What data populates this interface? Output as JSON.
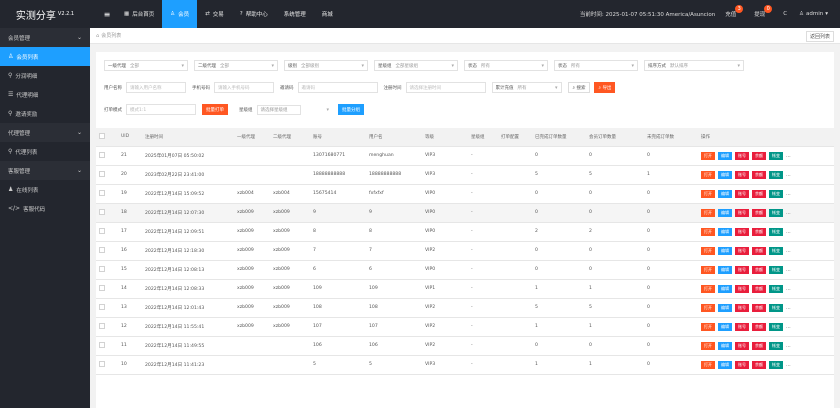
{
  "brand": {
    "name": "实测分享",
    "version": "V2.2.1"
  },
  "nav": [
    {
      "label": "后台首页",
      "icon": "home-icon"
    },
    {
      "label": "会员",
      "icon": "user-icon",
      "active": true
    },
    {
      "label": "交易",
      "icon": "exchange-icon"
    },
    {
      "label": "帮助中心",
      "icon": "help-icon"
    },
    {
      "label": "系统管理",
      "icon": ""
    },
    {
      "label": "商城",
      "icon": ""
    }
  ],
  "topright": {
    "time_label": "当前时间: 2025-01-07 05:51:30 America/Asuncion",
    "recharge": "充值",
    "recharge_badge": "3",
    "withdraw": "提现",
    "withdraw_badge": "0",
    "refresh_icon": "C",
    "user": "admin"
  },
  "sidebar": [
    {
      "label": "会员管理",
      "type": "group"
    },
    {
      "label": "会员列表",
      "type": "item",
      "active": true
    },
    {
      "label": "分润明细",
      "type": "item"
    },
    {
      "label": "代理明细",
      "type": "item"
    },
    {
      "label": "邀请奖励",
      "type": "item"
    },
    {
      "label": "代理管理",
      "type": "group"
    },
    {
      "label": "代理列表",
      "type": "item"
    },
    {
      "label": "客服管理",
      "type": "group"
    },
    {
      "label": "在线列表",
      "type": "item"
    },
    {
      "label": "客服代码",
      "type": "item"
    }
  ],
  "tabbar": {
    "tab": "会员列表",
    "btn": "返回列表"
  },
  "filters": {
    "row1": [
      {
        "label": "一级代理",
        "value": "全部"
      },
      {
        "label": "二级代理",
        "value": "全部"
      },
      {
        "label": "级别",
        "value": "全部级别"
      },
      {
        "label": "星级组",
        "value": "全部星级组"
      },
      {
        "label": "状态",
        "value": "所有"
      },
      {
        "label": "状态",
        "value": "所有"
      },
      {
        "label": "排序方式",
        "value": "默认排序"
      }
    ],
    "row2": {
      "user_label": "用户名称",
      "user_ph": "请输入用户名称",
      "phone_label": "手机号码",
      "phone_ph": "请输入手机号码",
      "reg_label": "邀请码",
      "reg_ph": "邀请码",
      "ip_label": "注册时间",
      "ip_ph": "请选择注册时间",
      "sort_label": "累计充值",
      "sort_value": "所有",
      "search_btn": "搜索",
      "export_btn": "导出"
    },
    "row3": {
      "label": "打单模式",
      "value": "模式1:1",
      "btn1": "批量打单",
      "star_label": "星级组",
      "star_value": "请选择星级组",
      "btn2": "批量分组"
    }
  },
  "table": {
    "headers": [
      "",
      "UID",
      "注册时间",
      "一级代理",
      "二级代理",
      "账号",
      "用户名",
      "等级",
      "星级组",
      "打单配置",
      "已完成订单数量",
      "会员订单数量",
      "未完成订单数",
      "操作"
    ],
    "rows": [
      {
        "uid": "21",
        "time": "2025年01月07日 05:50:02",
        "a1": "",
        "a2": "",
        "acct": "13071680771",
        "name": "menghuan",
        "level": "VIP3",
        "star": "-",
        "cfg": "",
        "c1": "0",
        "c2": "0",
        "c3": "0"
      },
      {
        "uid": "20",
        "time": "2023年02月22日 23:41:00",
        "a1": "",
        "a2": "",
        "acct": "18888888888",
        "name": "18888888888",
        "level": "VIP3",
        "star": "-",
        "cfg": "",
        "c1": "5",
        "c2": "5",
        "c3": "1"
      },
      {
        "uid": "19",
        "time": "2022年12月14日 15:09:52",
        "a1": "xzb004",
        "a2": "xzb004",
        "acct": "15675414",
        "name": "fxfxfxf",
        "level": "VIP0",
        "star": "-",
        "cfg": "",
        "c1": "0",
        "c2": "0",
        "c3": "0"
      },
      {
        "uid": "18",
        "time": "2022年12月14日 12:07:30",
        "a1": "xzb009",
        "a2": "xzb009",
        "acct": "9",
        "name": "9",
        "level": "VIP0",
        "star": "-",
        "cfg": "",
        "c1": "0",
        "c2": "0",
        "c3": "0"
      },
      {
        "uid": "17",
        "time": "2022年12月14日 12:09:51",
        "a1": "xzb009",
        "a2": "xzb009",
        "acct": "8",
        "name": "8",
        "level": "VIP0",
        "star": "-",
        "cfg": "",
        "c1": "2",
        "c2": "2",
        "c3": "0"
      },
      {
        "uid": "16",
        "time": "2022年12月14日 12:18:30",
        "a1": "xzb009",
        "a2": "xzb009",
        "acct": "7",
        "name": "7",
        "level": "VIP2",
        "star": "-",
        "cfg": "",
        "c1": "0",
        "c2": "0",
        "c3": "0"
      },
      {
        "uid": "15",
        "time": "2022年12月14日 12:08:13",
        "a1": "xzb009",
        "a2": "xzb009",
        "acct": "6",
        "name": "6",
        "level": "VIP0",
        "star": "-",
        "cfg": "",
        "c1": "0",
        "c2": "0",
        "c3": "0"
      },
      {
        "uid": "14",
        "time": "2022年12月14日 12:08:33",
        "a1": "xzb009",
        "a2": "xzb009",
        "acct": "109",
        "name": "109",
        "level": "VIP1",
        "star": "-",
        "cfg": "",
        "c1": "1",
        "c2": "1",
        "c3": "0"
      },
      {
        "uid": "13",
        "time": "2022年12月14日 12:01:43",
        "a1": "xzb009",
        "a2": "xzb009",
        "acct": "108",
        "name": "108",
        "level": "VIP2",
        "star": "-",
        "cfg": "",
        "c1": "5",
        "c2": "5",
        "c3": "0"
      },
      {
        "uid": "12",
        "time": "2022年12月14日 11:55:41",
        "a1": "xzb009",
        "a2": "xzb009",
        "acct": "107",
        "name": "107",
        "level": "VIP2",
        "star": "-",
        "cfg": "",
        "c1": "1",
        "c2": "1",
        "c3": "0"
      },
      {
        "uid": "11",
        "time": "2022年12月14日 11:49:55",
        "a1": "",
        "a2": "",
        "acct": "106",
        "name": "106",
        "level": "VIP2",
        "star": "-",
        "cfg": "",
        "c1": "0",
        "c2": "0",
        "c3": "0"
      },
      {
        "uid": "10",
        "time": "2022年12月14日 11:41:23",
        "a1": "",
        "a2": "",
        "acct": "5",
        "name": "5",
        "level": "VIP3",
        "star": "-",
        "cfg": "",
        "c1": "1",
        "c2": "1",
        "c3": "0"
      }
    ],
    "actions": [
      {
        "label": "打开",
        "color": "red"
      },
      {
        "label": "编辑",
        "color": "blue"
      },
      {
        "label": "账号",
        "color": "crimson"
      },
      {
        "label": "余额",
        "color": "crimson"
      },
      {
        "label": "帐变",
        "color": "teal"
      }
    ],
    "more": "..."
  },
  "colors": {
    "topbar": "#23262e",
    "accent": "#1e9fff",
    "orange": "#ff5722",
    "teal": "#009688"
  }
}
